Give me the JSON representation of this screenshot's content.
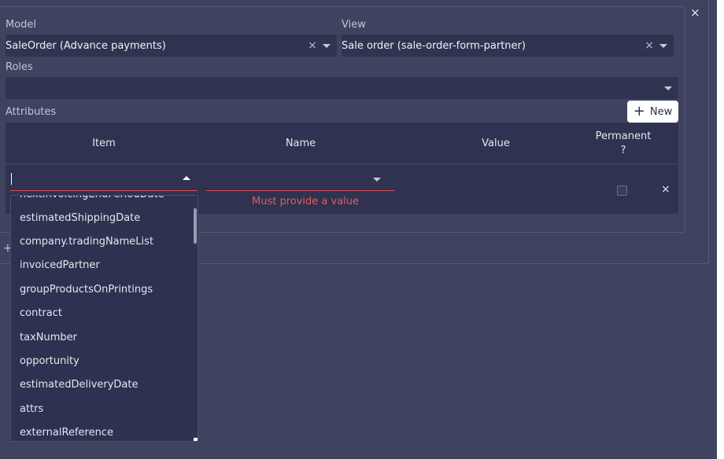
{
  "form": {
    "model_label": "Model",
    "model_value": "SaleOrder (Advance payments)",
    "view_label": "View",
    "view_value": "Sale order (sale-order-form-partner)",
    "roles_label": "Roles",
    "roles_value": "",
    "attributes_label": "Attributes",
    "clear_glyph": "×",
    "close_glyph": "×"
  },
  "toolbar": {
    "new_label": "New",
    "new_icon": "plus-icon"
  },
  "table": {
    "headers": [
      "Item",
      "Name",
      "Value",
      "Permanent\n?"
    ],
    "row": {
      "error_text": "Must provide a value",
      "permanent_checked": false,
      "delete_glyph": "×"
    }
  },
  "dropdown": {
    "items": [
      "nextInvoicingEndPeriodDate",
      "estimatedShippingDate",
      "company.tradingNameList",
      "invoicedPartner",
      "groupProductsOnPrintings",
      "contract",
      "taxNumber",
      "opportunity",
      "estimatedDeliveryDate",
      "attrs",
      "externalReference"
    ]
  },
  "misc": {
    "plus_stub": "+"
  },
  "colors": {
    "background": "#3f4360",
    "field": "#313451",
    "grid": "#2f3250",
    "error": "#e55a5a"
  }
}
